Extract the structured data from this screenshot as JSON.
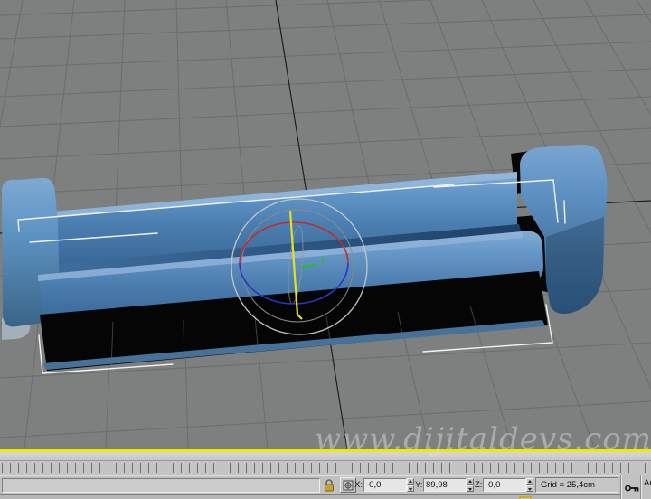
{
  "viewport": {
    "watermark_text": "www.dijitaldevs.com",
    "gizmo_axis_label": "y"
  },
  "status_bar": {
    "x_label": "X:",
    "x_value": "-0,0",
    "y_label": "Y:",
    "y_value": "89,98",
    "z_label": "Z:",
    "z_value": "-0,0",
    "grid_status": "Grid = 25,4cm",
    "auto_key_label": "Auto"
  },
  "colors": {
    "viewport_bg": "#7e8080",
    "grid_line": "#6b6c6c",
    "axis_line_dark": "#1e1e1e",
    "couch_blue": "#5b8fc2",
    "selection_white": "#f2f2f2",
    "active_border_yellow": "#eeea00",
    "gizmo_outer_gray": "#c6c6c2",
    "gizmo_red": "#c22b2b",
    "gizmo_blue": "#2a35c0",
    "gizmo_green": "#2eb82e",
    "gizmo_yellow": "#e4df25",
    "ui_chrome_gray": "#c1c1c1"
  },
  "icons": {
    "lock": "lock-icon",
    "absolute_mode": "absolute-mode-icon",
    "set_keys": "key-icon"
  }
}
